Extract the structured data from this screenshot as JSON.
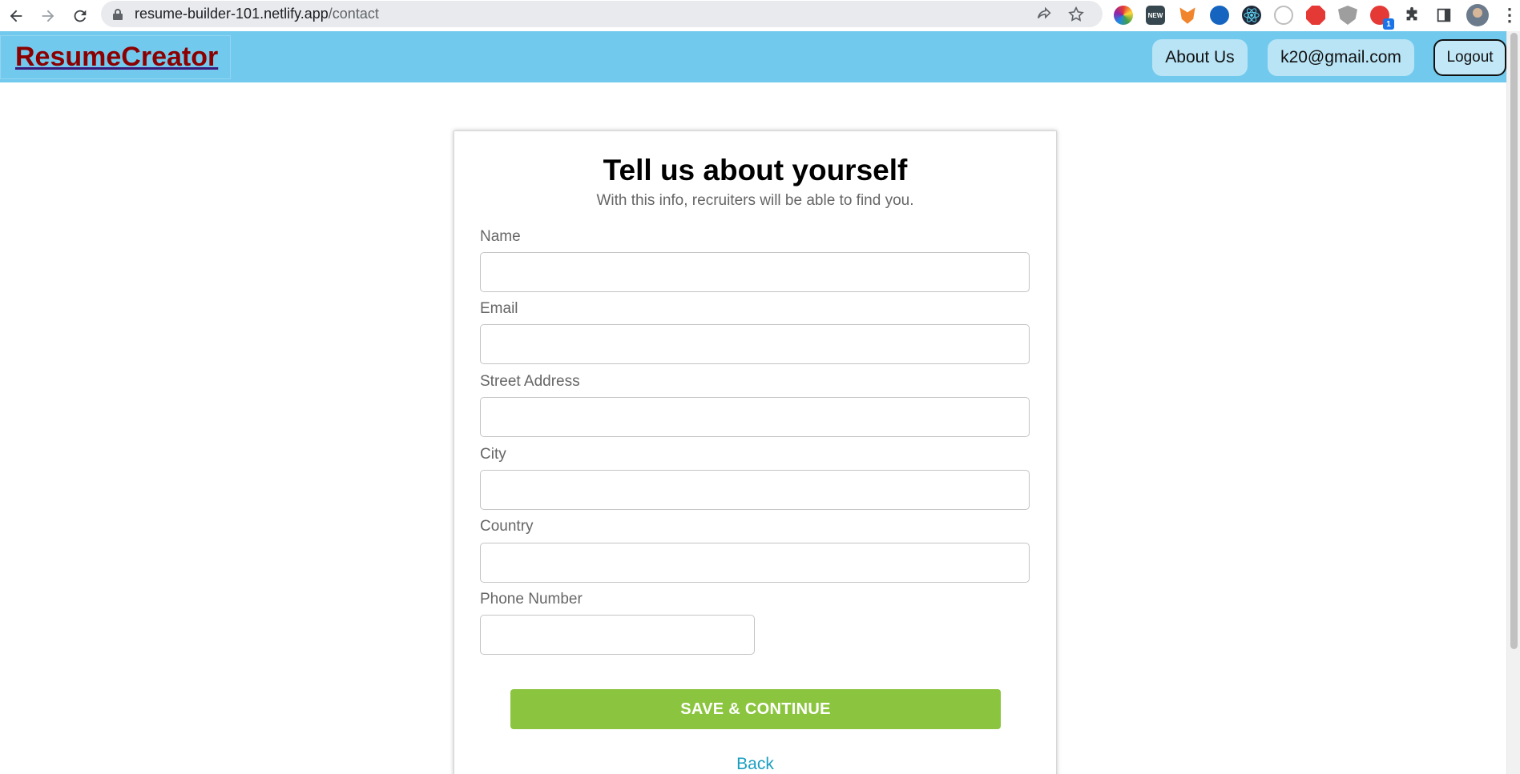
{
  "browser": {
    "url_host": "resume-builder-101.netlify.app",
    "url_path": "/contact",
    "extensions": [
      {
        "name": "color-wheel-icon",
        "color": "#e53935"
      },
      {
        "name": "new-badge-icon",
        "color": "#37474f",
        "label": "NEW"
      },
      {
        "name": "metamask-fox-icon",
        "color": "#f0852d"
      },
      {
        "name": "blue-circle-icon",
        "color": "#1565c0"
      },
      {
        "name": "react-atom-icon",
        "color": "#26c6da"
      },
      {
        "name": "circle-outline-icon",
        "color": "#bdbdbd"
      },
      {
        "name": "red-stop-hand-icon",
        "color": "#e53935"
      },
      {
        "name": "gray-shield-icon",
        "color": "#9e9e9e"
      },
      {
        "name": "red-shield-badge-icon",
        "color": "#e53935",
        "badge": "1"
      }
    ]
  },
  "header": {
    "brand": "ResumeCreator",
    "about_label": "About Us",
    "email_label": "k20@gmail.com",
    "logout_label": "Logout",
    "bg_color": "#71c9ee",
    "brand_color": "#8b0000"
  },
  "form": {
    "title": "Tell us about yourself",
    "subtitle": "With this info, recruiters will be able to find you.",
    "fields": [
      {
        "label": "Name",
        "value": ""
      },
      {
        "label": "Email",
        "value": ""
      },
      {
        "label": "Street Address",
        "value": ""
      },
      {
        "label": "City",
        "value": ""
      },
      {
        "label": "Country",
        "value": ""
      },
      {
        "label": "Phone Number",
        "value": ""
      }
    ],
    "save_label": "SAVE & CONTINUE",
    "back_label": "Back",
    "accent_color": "#8bc53f"
  }
}
